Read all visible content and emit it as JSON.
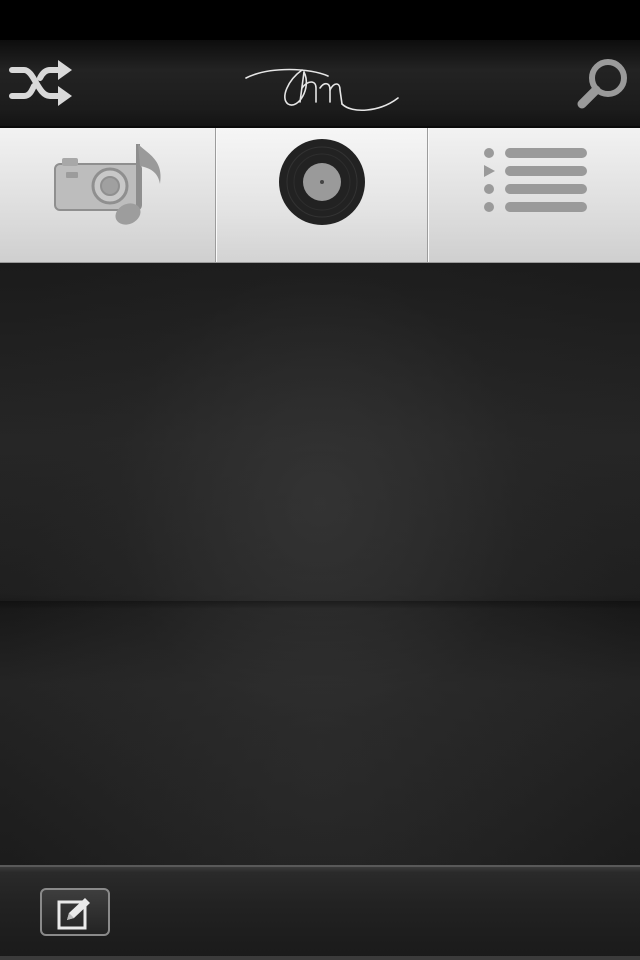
{
  "header": {
    "logo_text": "Ohm",
    "shuffle_icon": "shuffle-icon",
    "search_icon": "search-icon"
  },
  "tabs": [
    {
      "name": "photo-music",
      "icon": "camera-music-note-icon",
      "selected": false
    },
    {
      "name": "albums",
      "icon": "vinyl-record-icon",
      "selected": true
    },
    {
      "name": "playlist",
      "icon": "playlist-icon",
      "selected": false
    }
  ],
  "footer": {
    "edit_icon": "compose-edit-icon"
  },
  "colors": {
    "toolbar_dark": "#1c1c1c",
    "tab_light": "#e0e0e0",
    "icon_gray": "#8a8a8a",
    "record_black": "#222222"
  }
}
